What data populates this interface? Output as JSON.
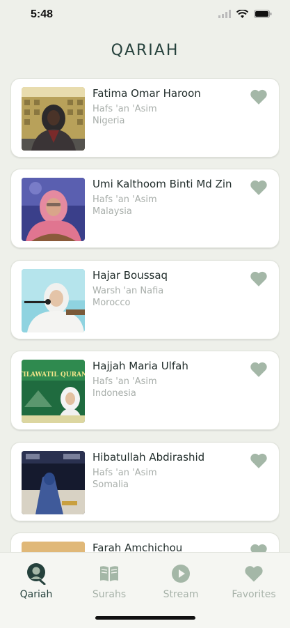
{
  "status_bar": {
    "time": "5:48"
  },
  "header": {
    "title": "QARIAH"
  },
  "reciters": [
    {
      "name": "Fatima Omar Haroon",
      "narration": "Hafs 'an 'Asim",
      "country": "Nigeria"
    },
    {
      "name": "Umi Kalthoom Binti Md Zin",
      "narration": "Hafs 'an 'Asim",
      "country": "Malaysia"
    },
    {
      "name": "Hajar Boussaq",
      "narration": "Warsh 'an Nafia",
      "country": "Morocco"
    },
    {
      "name": "Hajjah Maria Ulfah",
      "narration": "Hafs 'an 'Asim",
      "country": "Indonesia",
      "thumb_text": "TILAWATIL QURAN"
    },
    {
      "name": "Hibatullah Abdirashid",
      "narration": "Hafs 'an 'Asim",
      "country": "Somalia"
    },
    {
      "name": "Farah Amchichou",
      "narration": "",
      "country": ""
    }
  ],
  "bottom_nav": {
    "items": [
      {
        "label": "Qariah",
        "icon": "qariah-icon",
        "active": true
      },
      {
        "label": "Surahs",
        "icon": "book-icon",
        "active": false
      },
      {
        "label": "Stream",
        "icon": "play-icon",
        "active": false
      },
      {
        "label": "Favorites",
        "icon": "heart-icon",
        "active": false
      }
    ]
  },
  "colors": {
    "accent": "#25413c",
    "heart": "#a4b7a7",
    "inactive": "#a8b3aa",
    "background": "#eef0ea"
  }
}
